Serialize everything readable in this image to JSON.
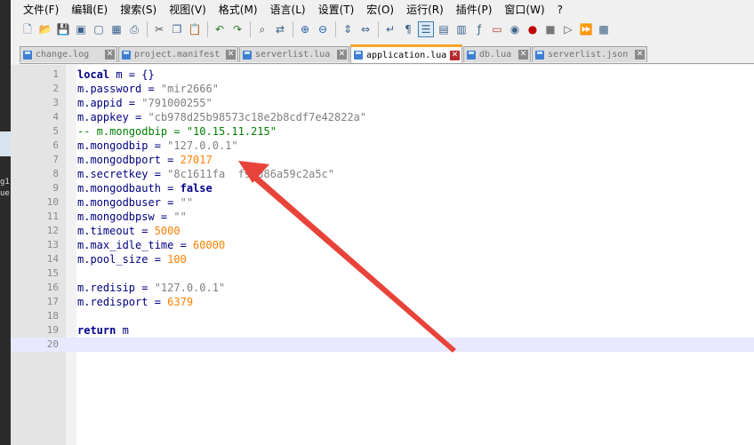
{
  "window": {
    "left_fragments": [
      "g1",
      "ue"
    ]
  },
  "menubar": {
    "items": [
      {
        "label": "文件(F)"
      },
      {
        "label": "编辑(E)"
      },
      {
        "label": "搜索(S)"
      },
      {
        "label": "视图(V)"
      },
      {
        "label": "格式(M)"
      },
      {
        "label": "语言(L)"
      },
      {
        "label": "设置(T)"
      },
      {
        "label": "宏(O)"
      },
      {
        "label": "运行(R)"
      },
      {
        "label": "插件(P)"
      },
      {
        "label": "窗口(W)"
      },
      {
        "label": "?"
      }
    ]
  },
  "toolbar": {
    "icons": [
      "new-file-icon",
      "open-file-icon",
      "save-icon",
      "save-all-icon",
      "close-icon",
      "close-all-icon",
      "print-icon",
      "cut-icon",
      "copy-icon",
      "paste-icon",
      "undo-icon",
      "redo-icon",
      "find-icon",
      "replace-icon",
      "zoom-in-icon",
      "zoom-out-icon",
      "sync-vertical-icon",
      "sync-horizontal-icon",
      "word-wrap-icon",
      "show-all-chars-icon",
      "indent-guide-icon",
      "language-icon",
      "doc-map-icon",
      "function-list-icon",
      "folder-workspace-icon",
      "monitor-icon",
      "record-macro-icon",
      "stop-record-icon",
      "play-macro-icon",
      "run-macro-multiple-icon",
      "save-macro-icon"
    ]
  },
  "tabs": [
    {
      "label": "change.log",
      "active": false
    },
    {
      "label": "project.manifest",
      "active": false
    },
    {
      "label": "serverlist.lua",
      "active": false
    },
    {
      "label": "application.lua",
      "active": true
    },
    {
      "label": "db.lua",
      "active": false
    },
    {
      "label": "serverlist.json",
      "active": false
    }
  ],
  "editor": {
    "current_line": 20,
    "lines": [
      [
        {
          "t": "kw",
          "s": "local"
        },
        {
          "t": "",
          "s": " m = {}"
        }
      ],
      [
        {
          "t": "",
          "s": "m.password = "
        },
        {
          "t": "str",
          "s": "\"mir2666\""
        }
      ],
      [
        {
          "t": "",
          "s": "m.appid = "
        },
        {
          "t": "str",
          "s": "\"791000255\""
        }
      ],
      [
        {
          "t": "",
          "s": "m.appkey = "
        },
        {
          "t": "str",
          "s": "\"cb978d25b98573c18e2b8cdf7e42822a\""
        }
      ],
      [
        {
          "t": "cmt",
          "s": "-- m.mongodbip = \"10.15.11.215\""
        }
      ],
      [
        {
          "t": "",
          "s": "m.mongodbip = "
        },
        {
          "t": "str",
          "s": "\"127.0.0.1\""
        }
      ],
      [
        {
          "t": "",
          "s": "m.mongodbport = "
        },
        {
          "t": "num",
          "s": "27017"
        }
      ],
      [
        {
          "t": "",
          "s": "m.secretkey = "
        },
        {
          "t": "str",
          "s": "\"8c1611fa  f94386a59c2a5c\""
        }
      ],
      [
        {
          "t": "",
          "s": "m.mongodbauth = "
        },
        {
          "t": "kw",
          "s": "false"
        }
      ],
      [
        {
          "t": "",
          "s": "m.mongodbuser = "
        },
        {
          "t": "str",
          "s": "\"\""
        }
      ],
      [
        {
          "t": "",
          "s": "m.mongodbpsw = "
        },
        {
          "t": "str",
          "s": "\"\""
        }
      ],
      [
        {
          "t": "",
          "s": "m.timeout = "
        },
        {
          "t": "num",
          "s": "5000"
        }
      ],
      [
        {
          "t": "",
          "s": "m.max_idle_time = "
        },
        {
          "t": "num",
          "s": "60000"
        }
      ],
      [
        {
          "t": "",
          "s": "m.pool_size = "
        },
        {
          "t": "num",
          "s": "100"
        }
      ],
      [],
      [
        {
          "t": "",
          "s": "m.redisip = "
        },
        {
          "t": "str",
          "s": "\"127.0.0.1\""
        }
      ],
      [
        {
          "t": "",
          "s": "m.redisport = "
        },
        {
          "t": "num",
          "s": "6379"
        }
      ],
      [],
      [
        {
          "t": "kw",
          "s": "return"
        },
        {
          "t": "",
          "s": " m"
        }
      ],
      []
    ]
  },
  "annotation": {
    "color": "#e8433a"
  }
}
